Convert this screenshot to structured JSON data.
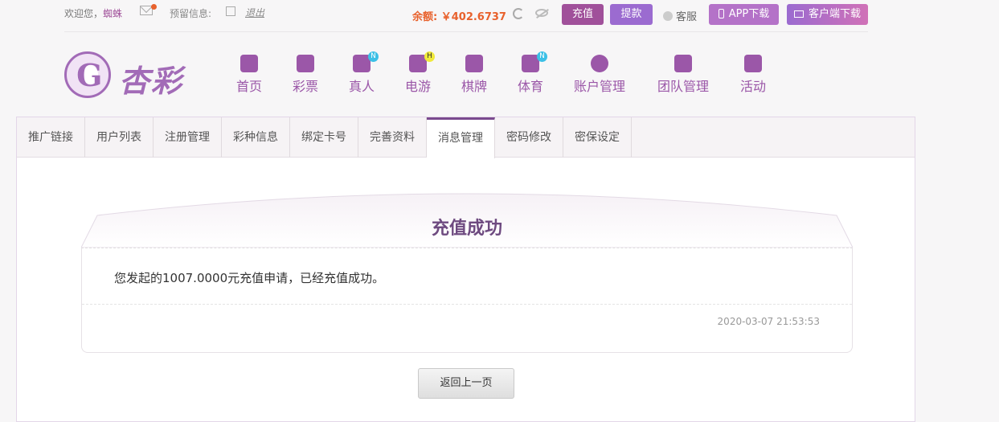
{
  "topbar": {
    "welcome": "欢迎您，",
    "username": "蜘蛛",
    "reserved_label": "预留信息:",
    "logout": "退出",
    "balance": "余额: ￥402.6737",
    "recharge": "充值",
    "withdraw": "提款",
    "service": "客服",
    "app_download": "APP下载",
    "client_download": "客户端下载"
  },
  "logo": {
    "text": "杏彩"
  },
  "nav": [
    {
      "label": "首页"
    },
    {
      "label": "彩票"
    },
    {
      "label": "真人",
      "badge": "N"
    },
    {
      "label": "电游",
      "badge": "H"
    },
    {
      "label": "棋牌"
    },
    {
      "label": "体育",
      "badge": "N"
    },
    {
      "label": "账户管理"
    },
    {
      "label": "团队管理"
    },
    {
      "label": "活动"
    }
  ],
  "tabs": [
    "推广链接",
    "用户列表",
    "注册管理",
    "彩种信息",
    "绑定卡号",
    "完善资料",
    "消息管理",
    "密码修改",
    "密保设定"
  ],
  "message": {
    "title": "充值成功",
    "body": "您发起的1007.0000元充值申请，已经充值成功。",
    "time": "2020-03-07 21:53:53"
  },
  "back_button": "返回上一页",
  "colors": {
    "accent": "#a0509a",
    "balance": "#e8612c",
    "nav": "#9b57a8"
  }
}
